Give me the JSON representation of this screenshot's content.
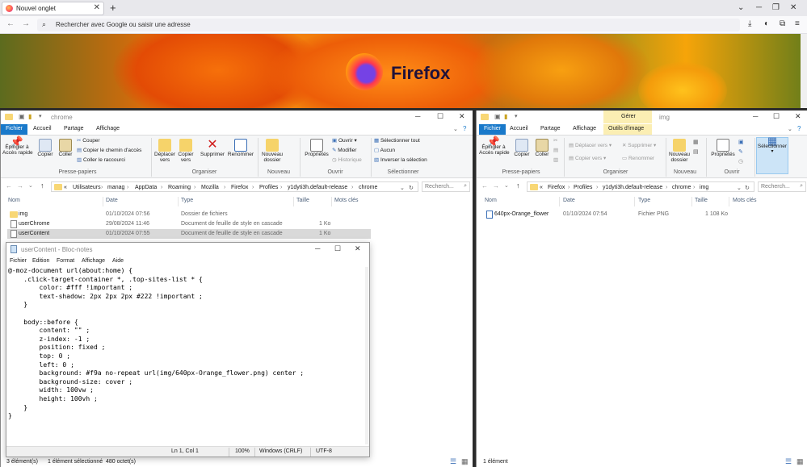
{
  "firefox": {
    "tab_label": "Nouvel onglet",
    "url_placeholder": "Rechercher avec Google ou saisir une adresse",
    "logo_text": "Firefox"
  },
  "left_explorer": {
    "title": "chrome",
    "ribbon_tabs": [
      "Fichier",
      "Accueil",
      "Partage",
      "Affichage"
    ],
    "ribbon": {
      "pin": "Épingler à\nAccès rapide",
      "copy": "Copier",
      "paste": "Coller",
      "cut": "Couper",
      "copy_path": "Copier le chemin d'accès",
      "paste_shortcut": "Coller le raccourci",
      "group_clipboard": "Presse-papiers",
      "move_to": "Déplacer\nvers",
      "copy_to": "Copier\nvers",
      "delete": "Supprimer",
      "rename": "Renommer",
      "group_organize": "Organiser",
      "new_folder": "Nouveau\ndossier",
      "group_new": "Nouveau",
      "properties": "Propriétés",
      "open": "Ouvrir",
      "modify": "Modifier",
      "history": "Historique",
      "group_open": "Ouvrir",
      "select_all": "Sélectionner tout",
      "select_none": "Aucun",
      "invert": "Inverser la sélection",
      "group_select": "Sélectionner"
    },
    "breadcrumb": [
      "«",
      "Utilisateurs",
      "manag",
      "AppData",
      "Roaming",
      "Mozilla",
      "Firefox",
      "Profiles",
      "y1dyti3h.default-release",
      "chrome"
    ],
    "search_placeholder": "Recherch...",
    "columns": [
      "Nom",
      "Date",
      "Type",
      "Taille",
      "Mots clés"
    ],
    "rows": [
      {
        "name": "img",
        "date": "01/10/2024 07:56",
        "type": "Dossier de fichiers",
        "size": ""
      },
      {
        "name": "userChrome",
        "date": "29/08/2024 11:46",
        "type": "Document de feuille de style en cascade",
        "size": "1 Ko"
      },
      {
        "name": "userContent",
        "date": "01/10/2024 07:55",
        "type": "Document de feuille de style en cascade",
        "size": "1 Ko"
      }
    ],
    "status_count": "3 élément(s)",
    "status_selected": "1 élément sélectionné  480 octet(s)"
  },
  "right_explorer": {
    "title": "img",
    "context_tab_header": "Gérer",
    "ribbon_tabs": [
      "Fichier",
      "Accueil",
      "Partage",
      "Affichage",
      "Outils d'image"
    ],
    "ribbon": {
      "pin": "Épingler à\nAccès rapide",
      "copy": "Copier",
      "paste": "Coller",
      "group_clipboard": "Presse-papiers",
      "move_to": "Déplacer vers",
      "copy_to": "Copier vers",
      "delete": "Supprimer",
      "rename": "Renommer",
      "group_organize": "Organiser",
      "new_folder": "Nouveau\ndossier",
      "group_new": "Nouveau",
      "properties": "Propriétés",
      "group_open": "Ouvrir",
      "select": "Sélectionner"
    },
    "breadcrumb": [
      "«",
      "Firefox",
      "Profiles",
      "y1dyti3h.default-release",
      "chrome",
      "img"
    ],
    "search_placeholder": "Recherch...",
    "columns": [
      "Nom",
      "Date",
      "Type",
      "Taille",
      "Mots clés"
    ],
    "rows": [
      {
        "name": "640px-Orange_flower",
        "date": "01/10/2024 07:54",
        "type": "Fichier PNG",
        "size": "1 108 Ko"
      }
    ],
    "status_count": "1 élément"
  },
  "notepad": {
    "title": "userContent - Bloc-notes",
    "menu": [
      "Fichier",
      "Edition",
      "Format",
      "Affichage",
      "Aide"
    ],
    "content": "@-moz-document url(about:home) {\n    .click-target-container *, .top-sites-list * {\n        color: #fff !important ;\n        text-shadow: 2px 2px 2px #222 !important ;\n    }\n\n    body::before {\n        content: \"\" ;\n        z-index: -1 ;\n        position: fixed ;\n        top: 0 ;\n        left: 0 ;\n        background: #f9a no-repeat url(img/640px-Orange_flower.png) center ;\n        background-size: cover ;\n        width: 100vw ;\n        height: 100vh ;\n    }\n}",
    "status_pos": "Ln 1, Col 1",
    "status_zoom": "100%",
    "status_eol": "Windows (CRLF)",
    "status_enc": "UTF-8"
  }
}
